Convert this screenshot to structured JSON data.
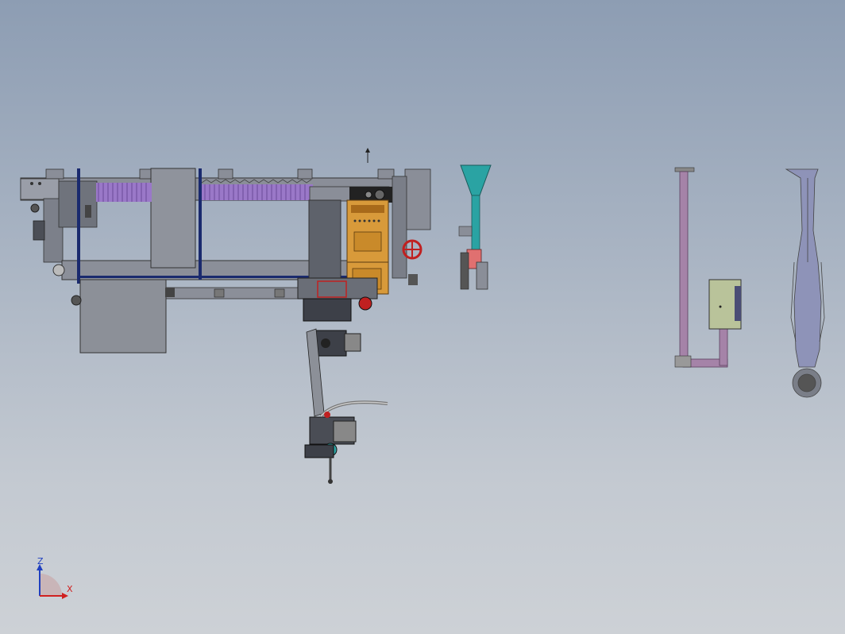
{
  "viewport": {
    "background_top": "#8d9db3",
    "background_bottom": "#cdd1d6"
  },
  "triad": {
    "z_label": "Z",
    "x_label": "X",
    "z_color": "#1f3fbf",
    "x_color": "#d02020"
  },
  "model_components": [
    {
      "name": "gantry-frame",
      "color": "#8a8e98"
    },
    {
      "name": "cable-chain-bellows",
      "color": "#9a78c8"
    },
    {
      "name": "welding-power-source",
      "color": "#d89a3a"
    },
    {
      "name": "robot-arm",
      "color": "#4a4d55"
    },
    {
      "name": "fume-extraction-funnel",
      "color": "#2aa3a3"
    },
    {
      "name": "exhaust-duct",
      "color": "#a583a8"
    },
    {
      "name": "control-box",
      "color": "#b9c39a"
    },
    {
      "name": "human-figure",
      "color": "#8e93b8"
    }
  ]
}
